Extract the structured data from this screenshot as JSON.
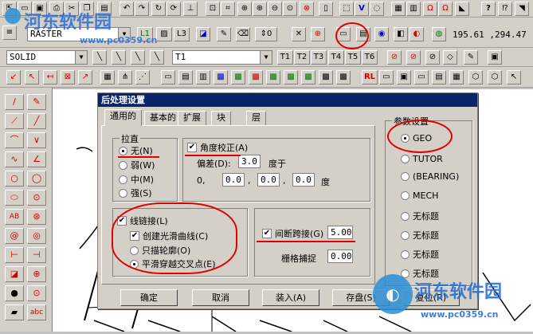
{
  "toolbar": {
    "row1_icons": [
      "pointer-icon",
      "open-file-icon",
      "save-icon",
      "print-icon",
      "cut-icon",
      "undo-icon",
      "redo-icon",
      "insert-icon",
      "copy-icon",
      "paste-icon",
      "zoom-window-icon",
      "zoom-in-icon",
      "zoom-out-icon",
      "zoom-fit-icon",
      "help-icon",
      "select-icon",
      "vector-icon",
      "eraser-icon",
      "grid-icon",
      "table-icon",
      "snap-icon",
      "measure-icon",
      "question-icon",
      "export-icon"
    ],
    "layer_value": "RASTER",
    "coordinates": "195.61 ,294.47",
    "linetype_value": "SOLID",
    "thickness_value": "T1",
    "thickness_buttons": [
      "T1",
      "T2",
      "T3",
      "T4",
      "T5",
      "T6"
    ]
  },
  "dialog": {
    "title": "后处理设置",
    "tabs": [
      "通用的",
      "基本的",
      "扩展",
      "块",
      "层"
    ],
    "straighten": {
      "label": "拉直",
      "options": [
        "无(N)",
        "弱(W)",
        "中(M)",
        "强(S)"
      ],
      "selected": "无(N)"
    },
    "angle": {
      "checkbox_label": "角度校正(A)",
      "checked": true,
      "tolerance_label": "偏差(D):",
      "tolerance_value": "3.0",
      "degree_label": "度于",
      "origin_label": "0,",
      "v1": "0.0",
      "v2": "0.0",
      "v3": "0.0",
      "unit": "度"
    },
    "line_join": {
      "checkbox_label": "线链接(L)",
      "checked": true,
      "smooth_label": "创建光滑曲线(C)",
      "smooth_checked": true,
      "options": [
        "只描轮廓(O)",
        "平滑穿越交叉点(E)"
      ],
      "selected": "平滑穿越交叉点(E)"
    },
    "gap": {
      "checkbox_label": "间断跨接(G)",
      "checked": true,
      "value": "5.00",
      "grid_label": "栅格捕捉",
      "grid_value": "0.00"
    },
    "params": {
      "label": "参数设置",
      "options": [
        "GEO",
        "TUTOR",
        "(BEARING)",
        "MECH",
        "无标题",
        "无标题",
        "无标题",
        "无标题"
      ],
      "selected": "GEO"
    },
    "buttons": {
      "ok": "确定",
      "cancel": "取消",
      "load": "装入(A)",
      "save": "存盘(S)",
      "reset": "复位(R)"
    }
  },
  "watermark": {
    "top_title": "河东软件园",
    "top_url": "www.pc0359.cn",
    "bottom_title": "河东软件园",
    "bottom_url": "www.pc0359.cn"
  }
}
